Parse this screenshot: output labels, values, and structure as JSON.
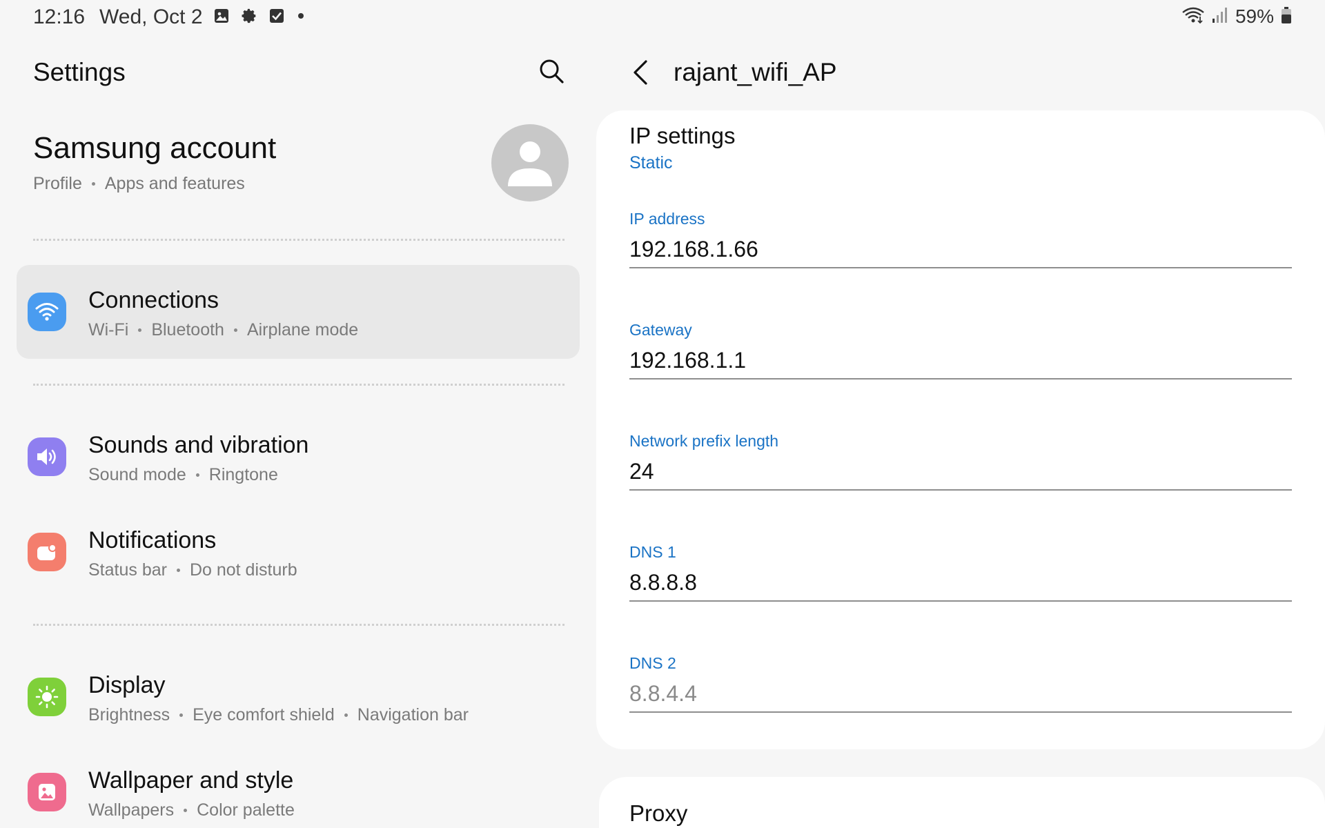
{
  "status_bar": {
    "time": "12:16",
    "date": "Wed, Oct 2",
    "battery": "59%",
    "icons_left": [
      "image-icon",
      "gear-icon",
      "checkbox-icon",
      "dot-icon"
    ],
    "icons_right": [
      "wifi-icon",
      "signal-icon",
      "battery-icon"
    ]
  },
  "left": {
    "title": "Settings",
    "account": {
      "title": "Samsung account",
      "sub": [
        "Profile",
        "Apps and features"
      ]
    },
    "items": [
      {
        "title": "Connections",
        "sub": [
          "Wi-Fi",
          "Bluetooth",
          "Airplane mode"
        ],
        "icon": "wifi-icon",
        "color": "#4a9cf0"
      },
      {
        "title": "Sounds and vibration",
        "sub": [
          "Sound mode",
          "Ringtone"
        ],
        "icon": "speaker-icon",
        "color": "#8f7ff0"
      },
      {
        "title": "Notifications",
        "sub": [
          "Status bar",
          "Do not disturb"
        ],
        "icon": "notification-icon",
        "color": "#f47e6d"
      },
      {
        "title": "Display",
        "sub": [
          "Brightness",
          "Eye comfort shield",
          "Navigation bar"
        ],
        "icon": "sun-icon",
        "color": "#7fd03a"
      },
      {
        "title": "Wallpaper and style",
        "sub": [
          "Wallpapers",
          "Color palette"
        ],
        "icon": "wallpaper-icon",
        "color": "#ef6b8e"
      }
    ]
  },
  "right": {
    "title": "rajant_wifi_AP",
    "ip_settings": {
      "label": "IP settings",
      "value": "Static"
    },
    "fields": [
      {
        "label": "IP address",
        "value": "192.168.1.66"
      },
      {
        "label": "Gateway",
        "value": "192.168.1.1"
      },
      {
        "label": "Network prefix length",
        "value": "24"
      },
      {
        "label": "DNS 1",
        "value": "8.8.8.8"
      },
      {
        "label": "DNS 2",
        "value": "8.8.4.4"
      }
    ],
    "proxy": "Proxy"
  },
  "colors": {
    "accent": "#1a73c5",
    "background": "#f6f6f6",
    "card": "#ffffff"
  }
}
